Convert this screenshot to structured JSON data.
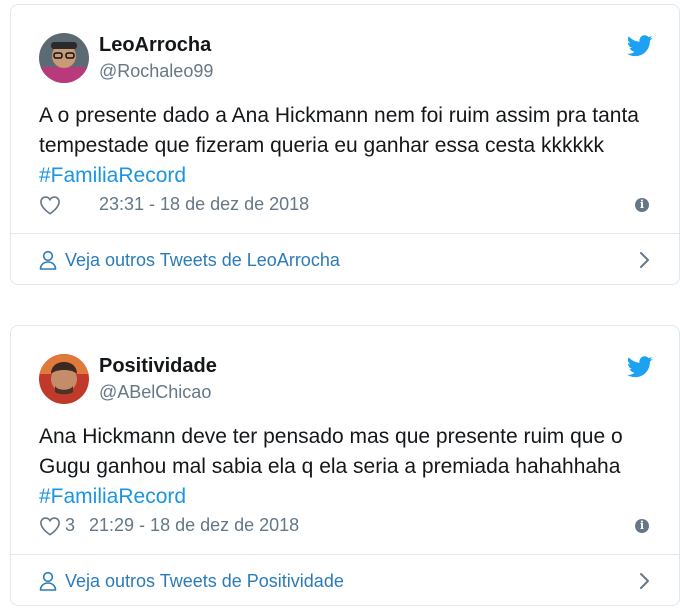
{
  "tweets": [
    {
      "display_name": "LeoArrocha",
      "handle": "@Rochaleo99",
      "text": "A o presente dado a Ana Hickmann nem foi ruim assim pra tanta tempestade que fizeram queria eu ganhar essa cesta kkkkkk ",
      "hashtag": "#FamiliaRecord",
      "like_count": "",
      "timestamp": "23:31 - 18 de dez de 2018",
      "more_tweets_label": "Veja outros Tweets de LeoArrocha",
      "icons": [
        "avatar",
        "twitter-bird-icon",
        "heart-icon",
        "info-icon",
        "person-icon",
        "chevron-right-icon"
      ]
    },
    {
      "display_name": "Positividade",
      "handle": "@ABelChicao",
      "text": "Ana Hickmann deve ter pensado mas que presente ruim que o Gugu ganhou mal sabia ela q ela seria a premiada hahahhaha ",
      "hashtag": "#FamiliaRecord",
      "like_count": "3",
      "timestamp": "21:29 - 18 de dez de 2018",
      "more_tweets_label": "Veja outros Tweets de Positividade",
      "icons": [
        "avatar",
        "twitter-bird-icon",
        "heart-icon",
        "info-icon",
        "person-icon",
        "chevron-right-icon"
      ]
    }
  ],
  "colors": {
    "brand_blue": "#1da1f2",
    "hashtag": "#1b95e0",
    "link": "#2b7bb9",
    "secondary_text": "#657786",
    "border": "#e1e8ed"
  }
}
